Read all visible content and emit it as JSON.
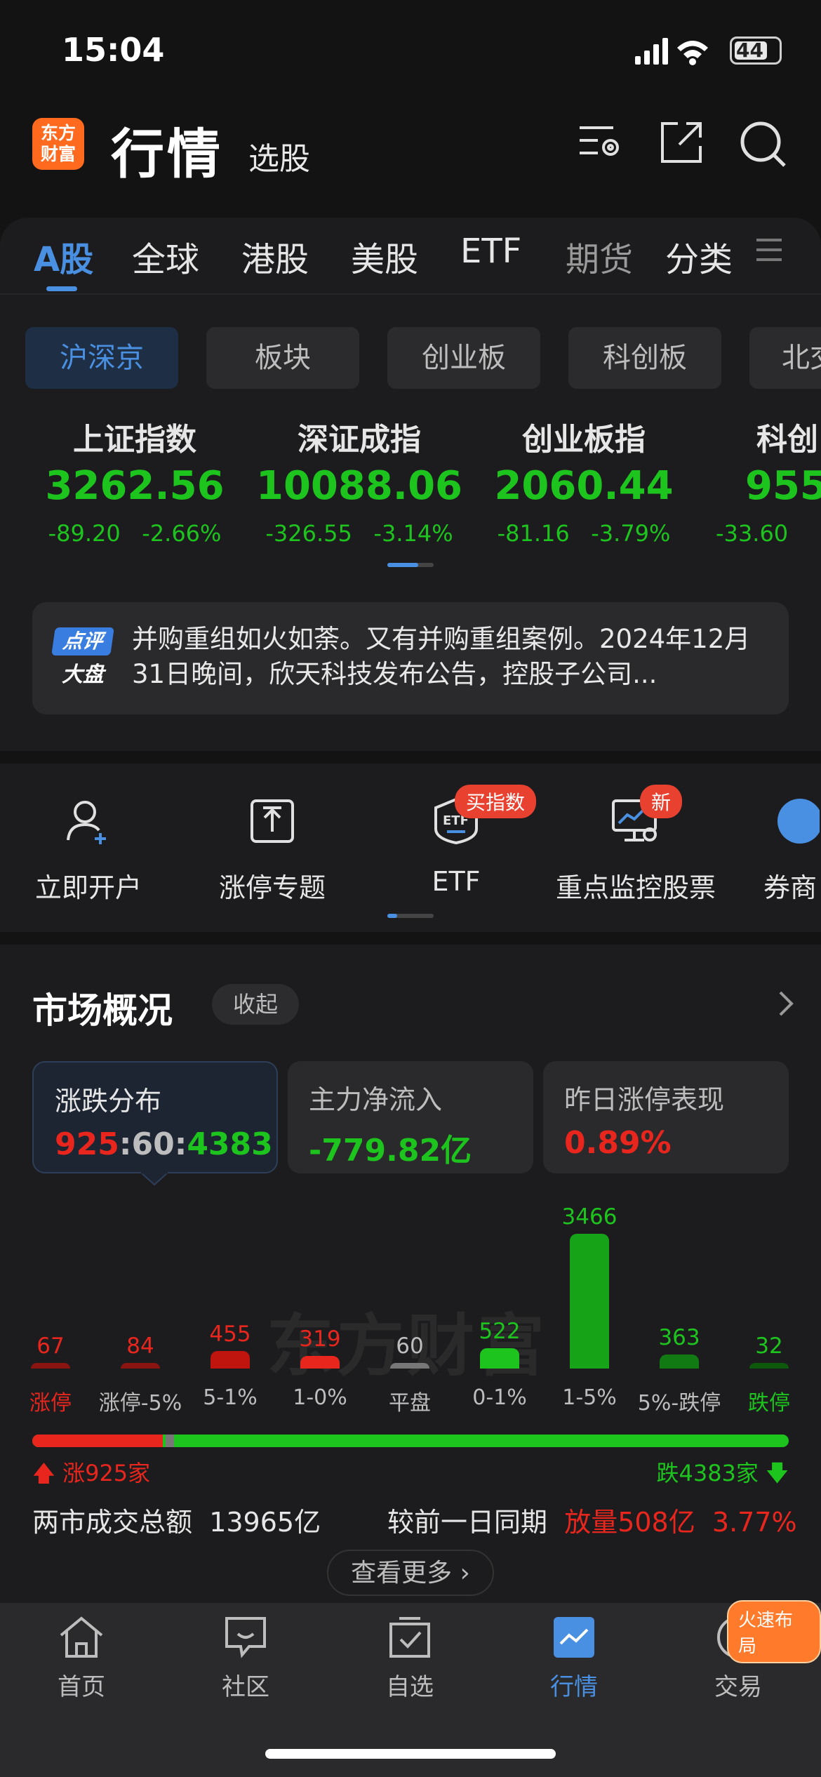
{
  "status": {
    "time": "15:04",
    "battery": "44"
  },
  "header": {
    "logo": "东方财富",
    "title": "行情",
    "subtitle": "选股"
  },
  "market_tabs": [
    "A股",
    "全球",
    "港股",
    "美股",
    "ETF",
    "期货",
    "分类"
  ],
  "sub_tabs": [
    "沪深京",
    "板块",
    "创业板",
    "科创板",
    "北交"
  ],
  "indices": [
    {
      "name": "上证指数",
      "value": "3262.56",
      "change": "-89.20",
      "pct": "-2.66%"
    },
    {
      "name": "深证成指",
      "value": "10088.06",
      "change": "-326.55",
      "pct": "-3.14%"
    },
    {
      "name": "创业板指",
      "value": "2060.44",
      "change": "-81.16",
      "pct": "-3.79%"
    },
    {
      "name": "科创",
      "value": "955",
      "change": "-33.60",
      "pct": ""
    }
  ],
  "news": {
    "badge_top": "点评",
    "badge_bottom": "大盘",
    "text": "并购重组如火如荼。又有并购重组案例。2024年12月31日晚间，欣天科技发布公告，控股子公司..."
  },
  "quick": [
    {
      "label": "立即开户",
      "icon": "user-add-icon",
      "tag": ""
    },
    {
      "label": "涨停专题",
      "icon": "upload-box-icon",
      "tag": ""
    },
    {
      "label": "ETF",
      "icon": "etf-icon",
      "tag": "买指数"
    },
    {
      "label": "重点监控股票",
      "icon": "monitor-icon",
      "tag": "新"
    },
    {
      "label": "券商",
      "icon": "broker-icon",
      "tag": ""
    }
  ],
  "overview": {
    "title": "市场概况",
    "collapse": "收起",
    "cards": [
      {
        "title": "涨跌分布",
        "up": "925",
        "flat": "60",
        "down": "4383"
      },
      {
        "title": "主力净流入",
        "value": "-779.82亿"
      },
      {
        "title": "昨日涨停表现",
        "value": "0.89%"
      }
    ],
    "watermark": "东方财富",
    "up_text": "涨925家",
    "down_text": "跌4383家",
    "volume_label": "两市成交总额",
    "volume_value": "13965亿",
    "compare_label": "较前一日同期",
    "compare_value": "放量508亿",
    "compare_pct": "3.77%",
    "more": "查看更多"
  },
  "chart_data": {
    "type": "bar",
    "categories": [
      "涨停",
      "涨停-5%",
      "5-1%",
      "1-0%",
      "平盘",
      "0-1%",
      "1-5%",
      "5%-跌停",
      "跌停"
    ],
    "values": [
      67,
      84,
      455,
      319,
      60,
      522,
      3466,
      363,
      32
    ],
    "colors": [
      "#8a1410",
      "#8a1410",
      "#c0140f",
      "#e8261d",
      "#777777",
      "#1ec41e",
      "#17a317",
      "#127a12",
      "#0d5a0d"
    ],
    "label_colors": [
      "#e8261d",
      "#e8261d",
      "#e8261d",
      "#e8261d",
      "#bdbdbd",
      "#1ec41e",
      "#1ec41e",
      "#1ec41e",
      "#1ec41e"
    ],
    "ylim": [
      0,
      3466
    ]
  },
  "nav": [
    {
      "label": "首页",
      "icon": "home-icon"
    },
    {
      "label": "社区",
      "icon": "chat-icon"
    },
    {
      "label": "自选",
      "icon": "checkbox-icon"
    },
    {
      "label": "行情",
      "icon": "chart-icon"
    },
    {
      "label": "交易",
      "icon": "plus-circle-icon"
    }
  ],
  "nav_hot": "火速布局",
  "colors": {
    "accent": "#4a90e2",
    "up": "#e8261d",
    "down": "#1ec41e"
  }
}
